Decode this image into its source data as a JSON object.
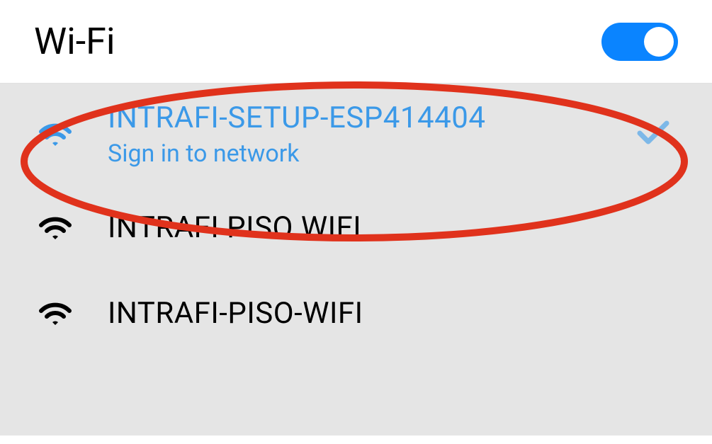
{
  "header": {
    "title": "Wi-Fi",
    "toggle_state": "on"
  },
  "colors": {
    "accent": "#0a84ff",
    "connected": "#3b99e8",
    "highlight": "#e0321c"
  },
  "networks": [
    {
      "name": "INTRAFI-SETUP-ESP414404",
      "status": "Sign in to network",
      "connected": true,
      "highlighted": true
    },
    {
      "name": "INTRAFI PISO WIFI",
      "connected": false
    },
    {
      "name": "INTRAFI-PISO-WIFI",
      "connected": false
    }
  ]
}
